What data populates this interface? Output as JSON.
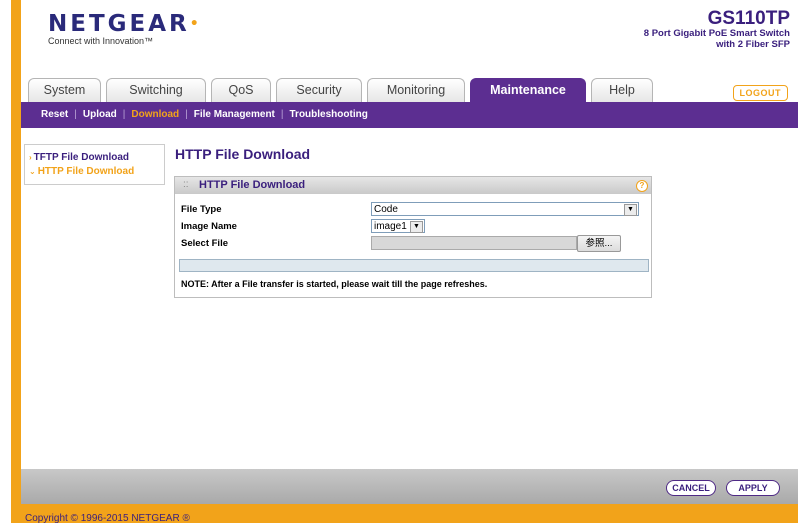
{
  "header": {
    "logo_text": "NETGEAR",
    "logo_tagline": "Connect with Innovation™",
    "model": "GS110TP",
    "model_desc_line1": "8 Port Gigabit PoE Smart Switch",
    "model_desc_line2": "with 2 Fiber SFP"
  },
  "tabs": [
    {
      "label": "System",
      "active": false
    },
    {
      "label": "Switching",
      "active": false
    },
    {
      "label": "QoS",
      "active": false
    },
    {
      "label": "Security",
      "active": false
    },
    {
      "label": "Monitoring",
      "active": false
    },
    {
      "label": "Maintenance",
      "active": true
    },
    {
      "label": "Help",
      "active": false
    }
  ],
  "logout_label": "LOGOUT",
  "subnav": [
    {
      "label": "Reset",
      "active": false
    },
    {
      "label": "Upload",
      "active": false
    },
    {
      "label": "Download",
      "active": true
    },
    {
      "label": "File Management",
      "active": false
    },
    {
      "label": "Troubleshooting",
      "active": false
    }
  ],
  "sidebar": {
    "items": [
      {
        "label": "TFTP File Download",
        "active": false
      },
      {
        "label": "HTTP File Download",
        "active": true
      }
    ]
  },
  "page_title": "HTTP File Download",
  "panel": {
    "title": "HTTP File Download",
    "help_symbol": "?",
    "file_type_label": "File Type",
    "file_type_value": "Code",
    "image_name_label": "Image Name",
    "image_name_value": "image1",
    "select_file_label": "Select File",
    "browse_label": "参照...",
    "note": "NOTE: After a File transfer is started, please wait till the page refreshes."
  },
  "footer": {
    "cancel_label": "CANCEL",
    "apply_label": "APPLY",
    "copyright": "Copyright © 1996-2015 NETGEAR ®"
  },
  "colors": {
    "brand_purple": "#5c2e91",
    "accent_orange": "#f2a31a"
  }
}
